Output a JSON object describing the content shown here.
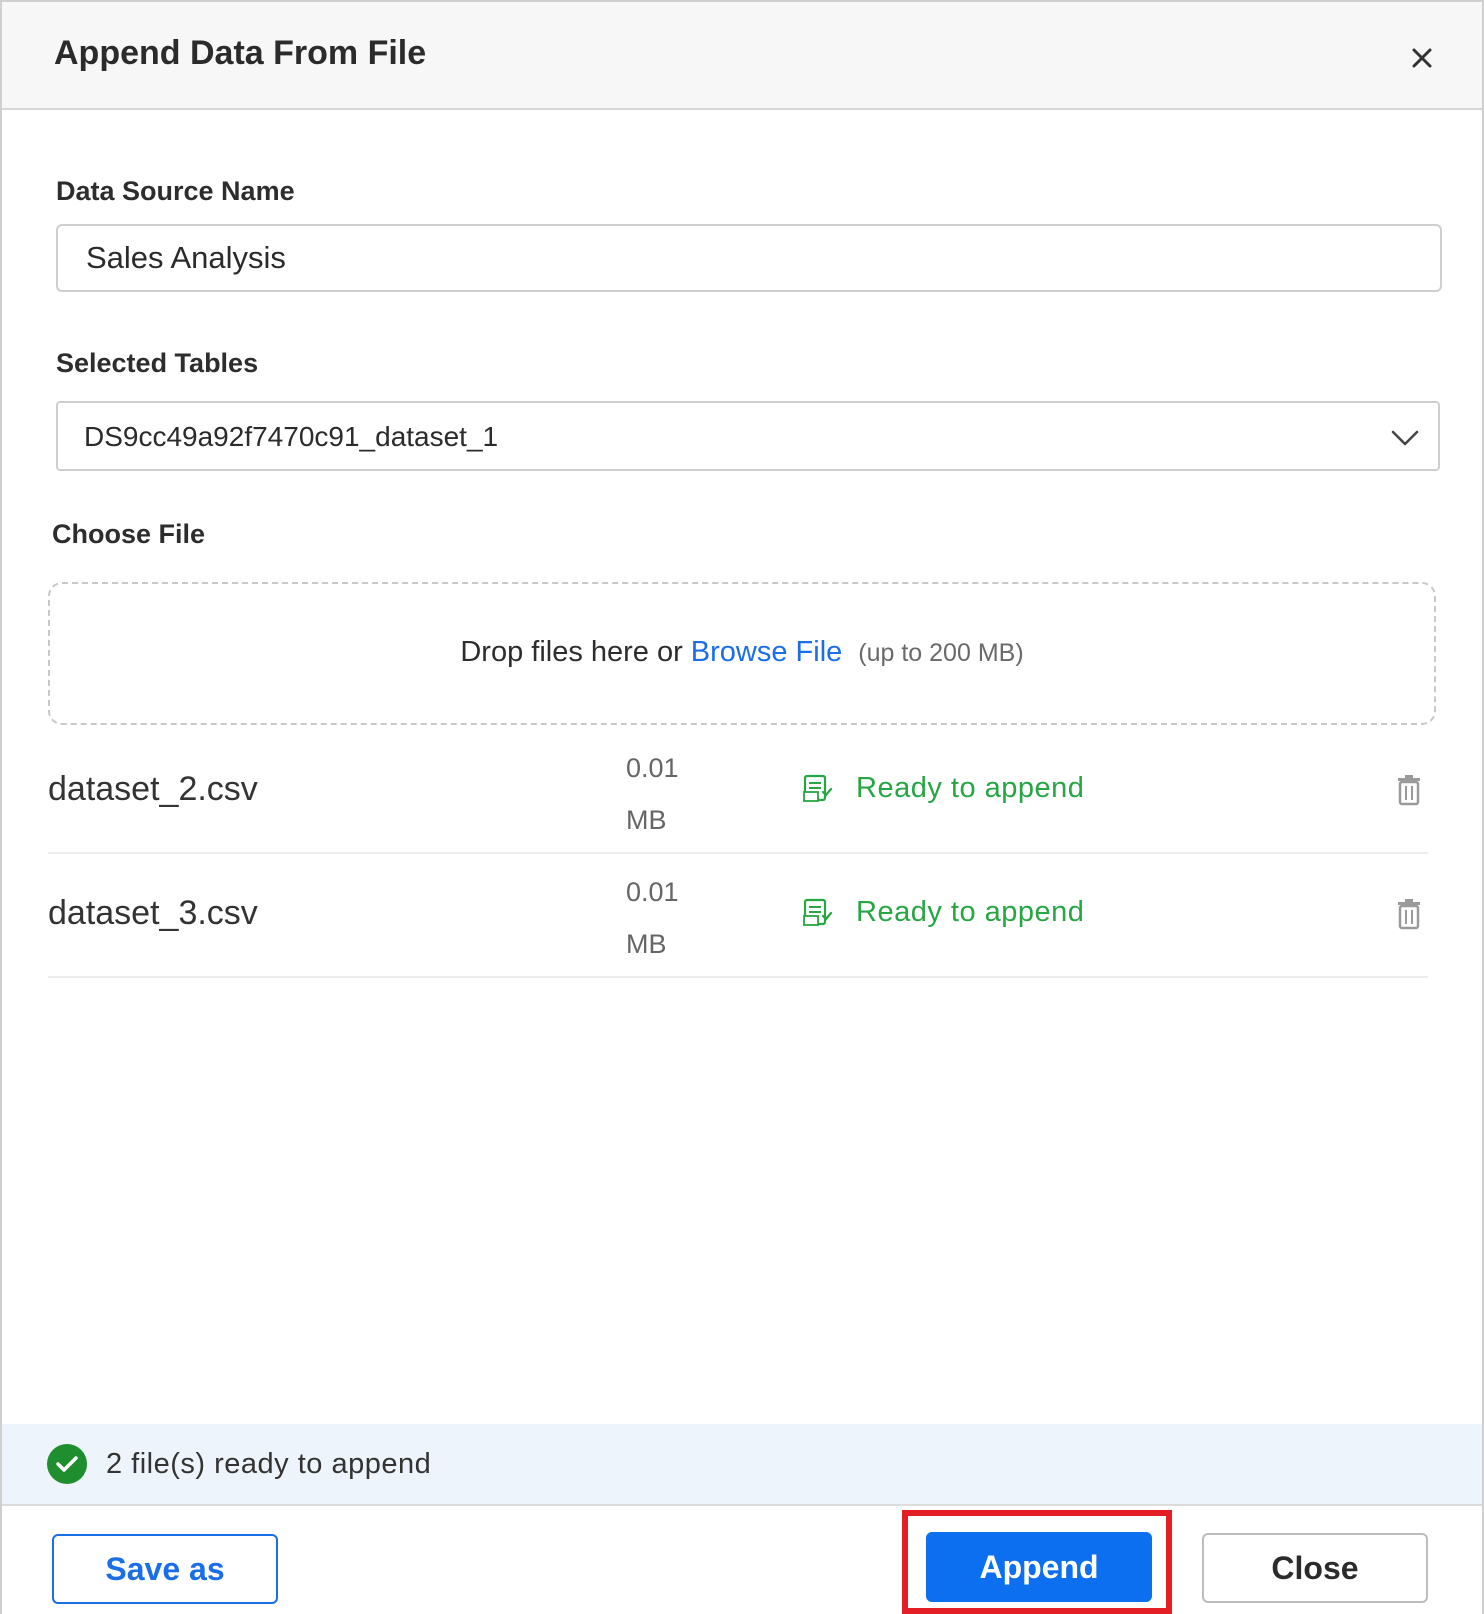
{
  "dialog": {
    "title": "Append Data From File",
    "close_icon": "close-icon"
  },
  "data_source": {
    "label": "Data Source Name",
    "value": "Sales Analysis"
  },
  "selected_tables": {
    "label": "Selected Tables",
    "value": "DS9cc49a92f7470c91_dataset_1",
    "icon": "chevron-down-icon"
  },
  "choose_file": {
    "label": "Choose File",
    "drop_text": "Drop files here or",
    "browse_label": "Browse File",
    "size_limit": "(up to 200 MB)"
  },
  "files": [
    {
      "name": "dataset_2.csv",
      "size_value": "0.01",
      "size_unit": "MB",
      "status": "Ready to append",
      "status_icon": "csv-ready-icon",
      "delete_icon": "trash-icon"
    },
    {
      "name": "dataset_3.csv",
      "size_value": "0.01",
      "size_unit": "MB",
      "status": "Ready to append",
      "status_icon": "csv-ready-icon",
      "delete_icon": "trash-icon"
    }
  ],
  "status_bar": {
    "text": "2 file(s) ready to append",
    "icon": "check-circle-icon"
  },
  "footer": {
    "save_as_label": "Save as",
    "append_label": "Append",
    "close_label": "Close"
  },
  "colors": {
    "accent": "#1a6fe8",
    "primary_button": "#0c6ff0",
    "success": "#27a644",
    "highlight": "#e41e25",
    "status_bar_bg": "#eef4fb"
  }
}
